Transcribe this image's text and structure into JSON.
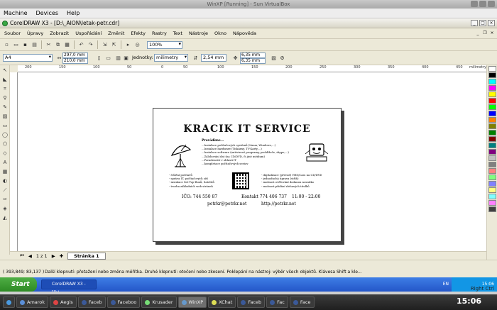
{
  "vbox": {
    "title": "WinXP [Running] - Sun VirtualBox",
    "menu": [
      "Machine",
      "Devices",
      "Help"
    ]
  },
  "corel": {
    "title": "CorelDRAW X3 - [D:\\_AION\\letak-petr.cdr]",
    "menu": [
      "Soubor",
      "Úpravy",
      "Zobrazit",
      "Uspořádání",
      "Změnit",
      "Efekty",
      "Rastry",
      "Text",
      "Nástroje",
      "Okno",
      "Nápověda"
    ],
    "zoom": "100%",
    "paper": "A4",
    "width": "297,0 mm",
    "height": "210,0 mm",
    "units_label": "Jednotky:",
    "units_value": "milimetry",
    "nudge": "2,54 mm",
    "dup_x": "6,35 mm",
    "dup_y": "6,35 mm",
    "ruler_units": "milimetry",
    "ruler_ticks": [
      "200",
      "150",
      "100",
      "50",
      "0",
      "50",
      "100",
      "150",
      "200",
      "250",
      "300",
      "350",
      "400",
      "450"
    ],
    "page_nav": "1 z 1",
    "page_tab": "Stránka 1"
  },
  "flyer": {
    "title": "KRACIK IT SERVICE",
    "services_heading": "Provádíme...",
    "services": [
      "...Instalace počítačových systémů (Linux, Windows,...)",
      "...Instalace hardware (Tiskárny, TV-Karty,...)",
      "...Instalace software (antivirové programy, prohlížeče, skype,...)",
      "...Zálohování dat (na CD/DVD, či jiné médium)",
      "...Poradenství v oblasti IT",
      "...kompletace počítačových sestav"
    ],
    "left_col": [
      "- čištění počítačů",
      "- správa IT, počítačových sítí",
      "- instalace Set-Top-Boxů, Satelitů",
      "- tvorba základních web stránek"
    ],
    "right_col": [
      "- digitalizace (převod) VHS/Cass na CD/DVD",
      "- jednoduchá úprava (střih)",
      "- možnost ověřování dodanou nosnitko",
      "- možnost přidání zlehavých titulků"
    ],
    "ico": "IČO: 744 550 87",
    "phone": "Kontakt 774 406 737",
    "hours": "11:00 - 22:00",
    "email": "petrkr@petrkr.net",
    "web": "http://petrkr.net"
  },
  "status": {
    "coords": "( 393,849; 83,137 )",
    "hint": "Další klepnutí: přetažení nebo změna měřítka. Druhé klepnutí: otočení nebo zkosení. Poklepání na nástroj: výběr všech objektů. Klávesa Shift a kle..."
  },
  "guest_taskbar": {
    "start": "Start",
    "task": "CorelDRAW X3 - [D:\\...",
    "lang": "EN",
    "time": "15:06"
  },
  "host": {
    "right_ctrl": "Right Ctrl",
    "clock": "15:06",
    "tasks": [
      "Amarok",
      "Aegis",
      "Faceb",
      "Faceboo",
      "Krusader",
      "WinXP",
      "XChat",
      "Faceb",
      "Fac",
      "Face"
    ]
  },
  "palette": [
    "#ffffff",
    "#000000",
    "#00ffff",
    "#ff00ff",
    "#ffff00",
    "#ff0000",
    "#00ff00",
    "#0000ff",
    "#ff8000",
    "#808000",
    "#008000",
    "#800000",
    "#008080",
    "#800080",
    "#c0c0c0",
    "#808080",
    "#ff8080",
    "#80ff80",
    "#8080ff",
    "#ffff80",
    "#80ffff",
    "#ff80ff",
    "#404040"
  ]
}
